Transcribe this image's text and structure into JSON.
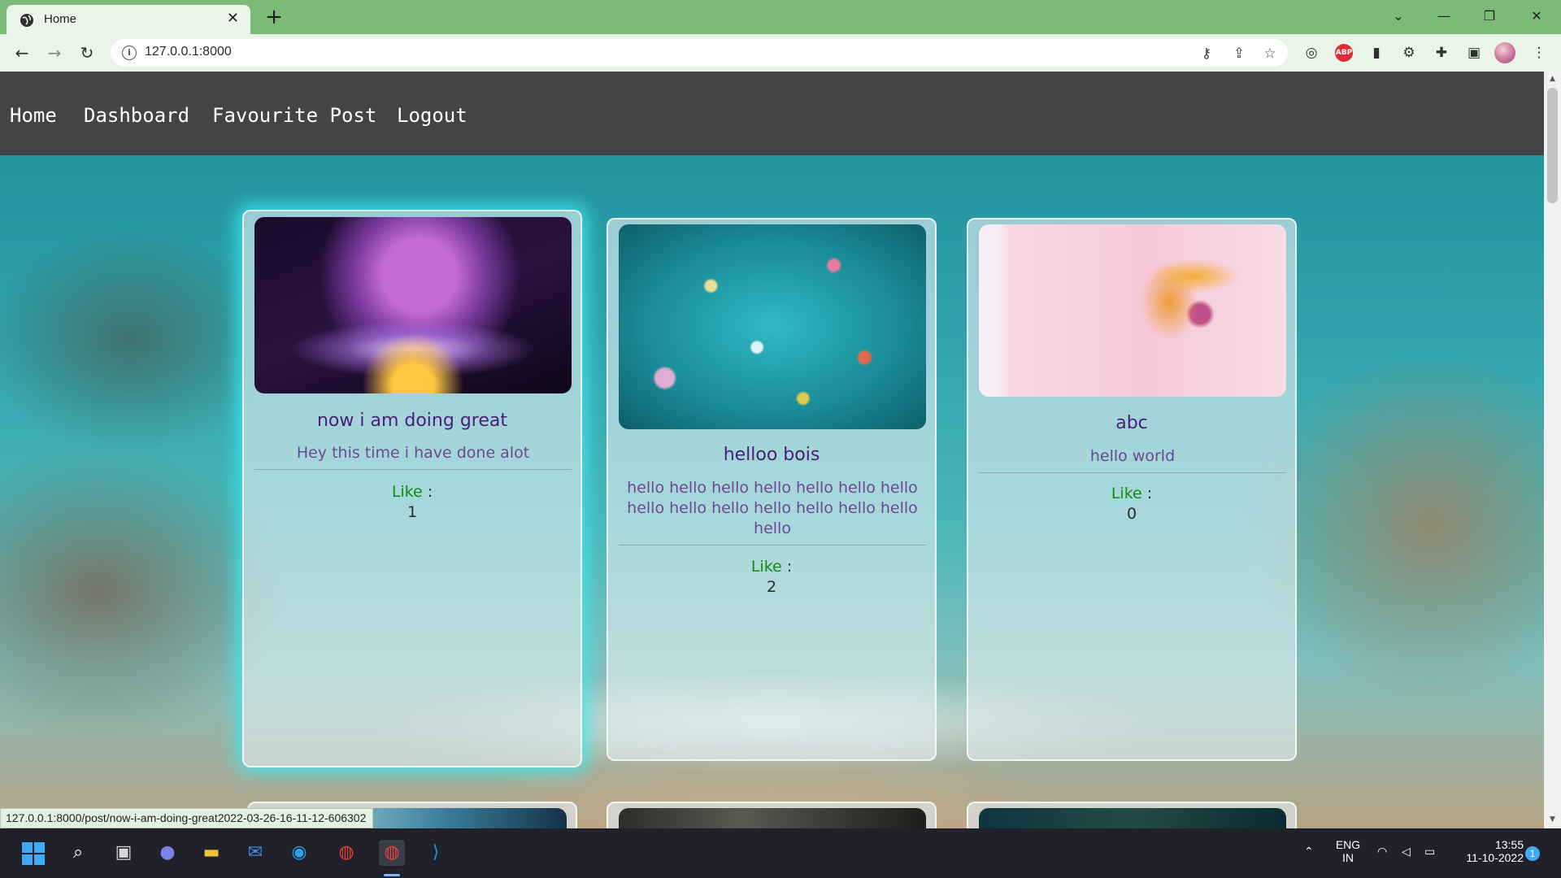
{
  "browser": {
    "tab_title": "Home",
    "url": "127.0.0.1:8000",
    "status_url": "127.0.0.1:8000/post/now-i-am-doing-great2022-03-26-16-11-12-606302",
    "icons": {
      "back": "arrow-left-icon",
      "forward": "arrow-right-icon",
      "reload": "reload-icon",
      "key": "key-icon",
      "share": "share-icon",
      "bookmark": "star-icon",
      "abp_label": "ABP"
    }
  },
  "navbar": {
    "items": [
      {
        "label": "Home"
      },
      {
        "label": "Dashboard"
      },
      {
        "label": "Favourite Post"
      },
      {
        "label": "Logout"
      }
    ]
  },
  "posts": [
    {
      "title": "now i am doing great",
      "text": "Hey this time i have done alot",
      "like_label": "Like",
      "like_sep": ":",
      "likes": "1"
    },
    {
      "title": "helloo bois",
      "text": "hello hello hello hello hello hello hello hello hello hello hello hello hello hello hello",
      "like_label": "Like",
      "like_sep": ":",
      "likes": "2"
    },
    {
      "title": "abc",
      "text": "hello world",
      "like_label": "Like",
      "like_sep": ":",
      "likes": "0"
    }
  ],
  "taskbar": {
    "language": "ENG",
    "region": "IN",
    "time": "13:55",
    "date": "11-10-2022",
    "notification_count": "1"
  },
  "colors": {
    "tabstrip": "#7cba78",
    "navbar": "#444444",
    "title": "#4b1e7a",
    "like": "#148a14",
    "glow": "#3cebf5"
  }
}
